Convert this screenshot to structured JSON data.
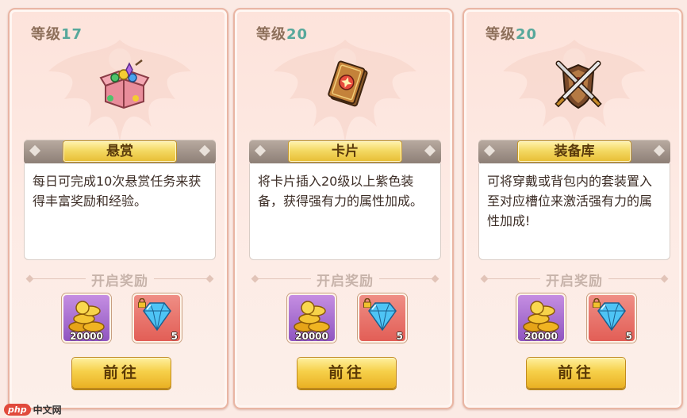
{
  "cards": [
    {
      "level_label": "等级",
      "level_value": "17",
      "icon": "bounty-chest-icon",
      "title": "悬赏",
      "description": "每日可完成10次悬赏任务来获得丰富奖励和经验。",
      "rewards_heading": "开启奖励",
      "rewards": [
        {
          "icon": "gold-coins-icon",
          "count": "20000"
        },
        {
          "icon": "diamond-icon",
          "count": "5",
          "locked": true
        }
      ],
      "go_label": "前往"
    },
    {
      "level_label": "等级",
      "level_value": "20",
      "icon": "card-icon",
      "title": "卡片",
      "description": "将卡片插入20级以上紫色装备，获得强有力的属性加成。",
      "rewards_heading": "开启奖励",
      "rewards": [
        {
          "icon": "gold-coins-icon",
          "count": "20000"
        },
        {
          "icon": "diamond-icon",
          "count": "5",
          "locked": true
        }
      ],
      "go_label": "前往"
    },
    {
      "level_label": "等级",
      "level_value": "20",
      "icon": "armory-shield-swords-icon",
      "title": "装备库",
      "description": "可将穿戴或背包内的套装置入至对应槽位来激活强有力的属性加成!",
      "rewards_heading": "开启奖励",
      "rewards": [
        {
          "icon": "gold-coins-icon",
          "count": "20000"
        },
        {
          "icon": "diamond-icon",
          "count": "5",
          "locked": true
        }
      ],
      "go_label": "前往"
    }
  ],
  "watermark": {
    "badge": "php",
    "text": "中文网"
  },
  "colors": {
    "level_number": "#57a89b",
    "go_button": "#f6d04a",
    "gold_reward_bg": "#a56fd1",
    "gem_reward_bg": "#e8746b"
  }
}
